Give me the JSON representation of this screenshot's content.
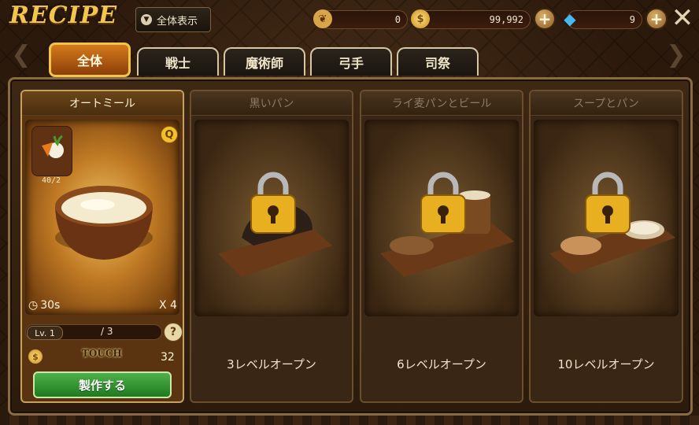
{
  "header": {
    "title": "RECIPE",
    "filter_label": "全体表示"
  },
  "resources": {
    "stamina": "0",
    "gold": "99,992",
    "gems": "9"
  },
  "tabs": [
    {
      "label": "全体",
      "active": true
    },
    {
      "label": "戦士",
      "active": false
    },
    {
      "label": "魔術師",
      "active": false
    },
    {
      "label": "弓手",
      "active": false
    },
    {
      "label": "司祭",
      "active": false
    }
  ],
  "recipes": [
    {
      "name": "オートミール",
      "ingredient_count": "40/2",
      "quality_badge": "Q",
      "time": "30s",
      "multiplier": "X 4",
      "level": "Lv. 1",
      "progress": "/ 3",
      "touch_label": "TOUCH",
      "cost": "32",
      "craft_label": "製作する"
    },
    {
      "name": "黒いパン",
      "unlock_text": "3レベルオープン"
    },
    {
      "name": "ライ麦パンとビール",
      "unlock_text": "6レベルオープン"
    },
    {
      "name": "スープとパン",
      "unlock_text": "10レベルオープン"
    }
  ],
  "colors": {
    "accent": "#f2c64e",
    "active_tab": "#d57a1c",
    "craft_button": "#3c9a38"
  }
}
